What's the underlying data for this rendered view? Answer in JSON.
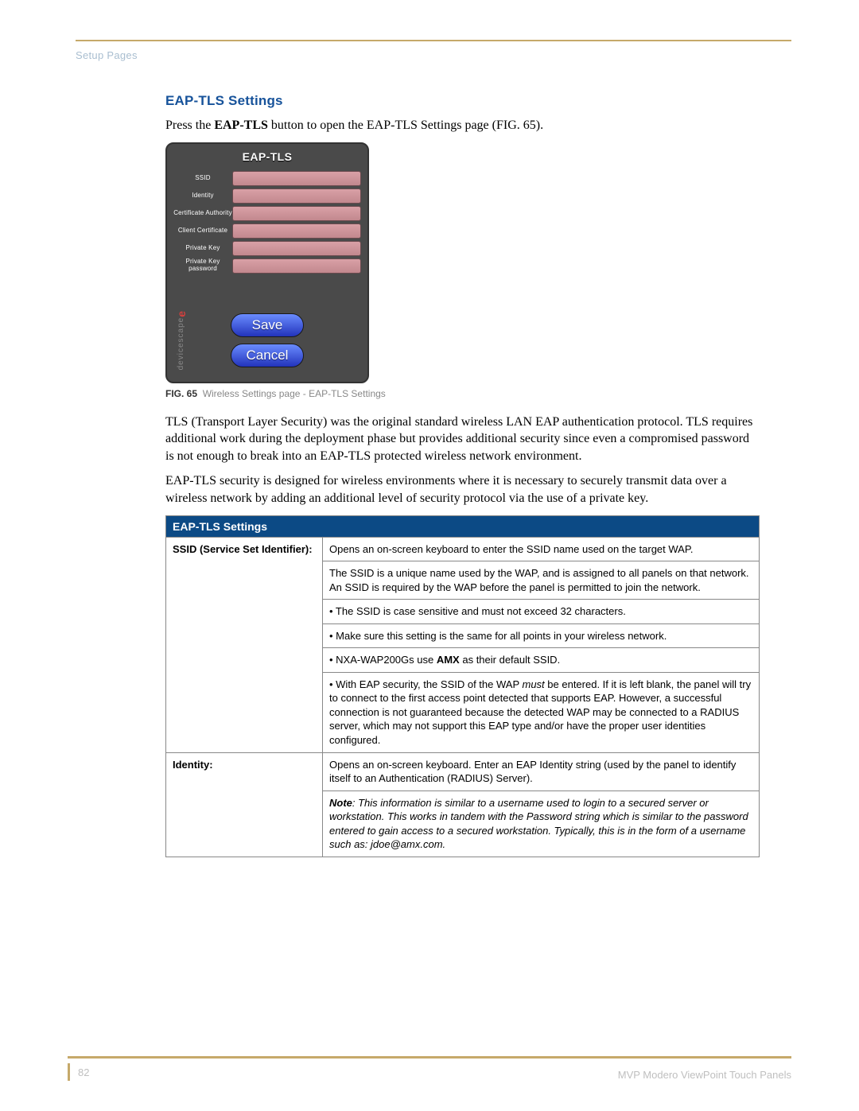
{
  "header": {
    "section": "Setup Pages"
  },
  "title": "EAP-TLS Settings",
  "intro_pre": "Press the ",
  "intro_bold": "EAP-TLS",
  "intro_post": " button to open the EAP-TLS Settings page (FIG. 65).",
  "screenshot": {
    "title": "EAP-TLS",
    "fields": [
      {
        "label": "SSID"
      },
      {
        "label": "Identity"
      },
      {
        "label": "Certificate Authority"
      },
      {
        "label": "Client Certificate"
      },
      {
        "label": "Private Key"
      },
      {
        "label": "Private Key password"
      }
    ],
    "save": "Save",
    "cancel": "Cancel",
    "sidetext": "devicescape"
  },
  "caption": {
    "fig": "FIG. 65",
    "text": "Wireless Settings page - EAP-TLS Settings"
  },
  "para1": "TLS (Transport Layer Security) was the original standard wireless LAN EAP authentication protocol. TLS requires additional work during the deployment phase but provides additional security since even a compromised password is not enough to break into an EAP-TLS protected wireless network environment.",
  "para2": "EAP-TLS security is designed for wireless environments where it is necessary to securely transmit data over a wireless network by adding an additional level of security protocol via the use of a private key.",
  "table": {
    "header": "EAP-TLS Settings",
    "rows": [
      {
        "key": "SSID (Service Set Identifier):",
        "cells": [
          "Opens an on-screen keyboard to enter the SSID name used on the target WAP.",
          "The SSID is a unique name used by the WAP, and is assigned to all panels on that network. An SSID is required by the WAP before the panel is permitted to join the network.",
          "• The SSID is case sensitive and must not exceed 32 characters.",
          "• Make sure this setting is the same for all points in your wireless network.",
          {
            "pre": "• NXA-WAP200Gs use ",
            "bold": "AMX",
            "post": " as their default SSID."
          },
          {
            "pre": "• With EAP security, the SSID of the WAP ",
            "ital": "must",
            "post": " be entered. If it is left blank, the panel will try to connect to the first access point detected that supports EAP. However, a successful connection is not guaranteed because the detected WAP may be connected to a RADIUS server, which may not support this EAP type and/or have the proper user identities configured."
          }
        ]
      },
      {
        "key": "Identity:",
        "cells": [
          "Opens an on-screen keyboard. Enter an EAP Identity string (used by the panel to identify itself to an Authentication (RADIUS) Server).",
          {
            "note_label": "Note",
            "note_text": ": This information is similar to a username used to login to a secured server or workstation. This works in tandem with the Password string which is similar to the password entered to gain access to a secured workstation. Typically, this is in the form of a username such as: jdoe@amx.com."
          }
        ]
      }
    ]
  },
  "footer": {
    "page": "82",
    "doc": "MVP Modero ViewPoint Touch Panels"
  }
}
